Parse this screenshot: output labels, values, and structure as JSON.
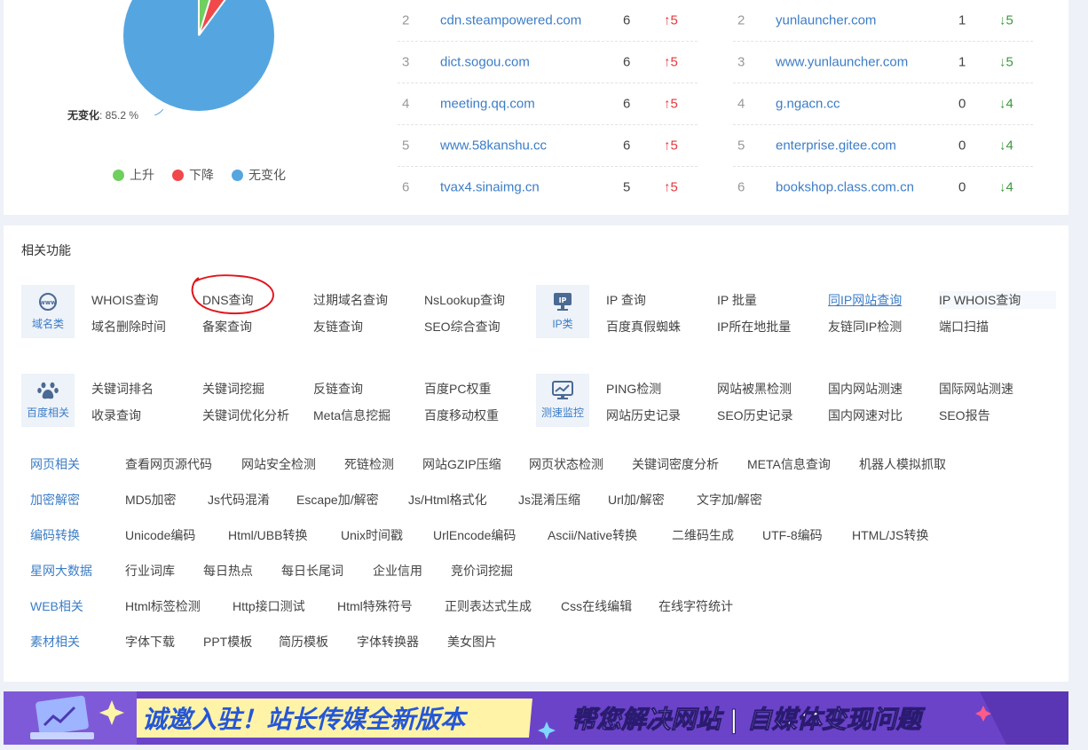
{
  "pie": {
    "label_name": "无变化",
    "label_value": ": 85.2 %",
    "legend": [
      {
        "label": "上升",
        "color": "#6fcf5f"
      },
      {
        "label": "下降",
        "color": "#f0484b"
      },
      {
        "label": "无变化",
        "color": "#55a6e0"
      }
    ]
  },
  "rank_up": [
    {
      "idx": "2",
      "domain": "cdn.steampowered.com",
      "count": "6",
      "change": "5"
    },
    {
      "idx": "3",
      "domain": "dict.sogou.com",
      "count": "6",
      "change": "5"
    },
    {
      "idx": "4",
      "domain": "meeting.qq.com",
      "count": "6",
      "change": "5"
    },
    {
      "idx": "5",
      "domain": "www.58kanshu.cc",
      "count": "6",
      "change": "5"
    },
    {
      "idx": "6",
      "domain": "tvax4.sinaimg.cn",
      "count": "5",
      "change": "5"
    }
  ],
  "rank_down": [
    {
      "idx": "2",
      "domain": "yunlauncher.com",
      "count": "1",
      "change": "5"
    },
    {
      "idx": "3",
      "domain": "www.yunlauncher.com",
      "count": "1",
      "change": "5"
    },
    {
      "idx": "4",
      "domain": "g.ngacn.cc",
      "count": "0",
      "change": "4"
    },
    {
      "idx": "5",
      "domain": "enterprise.gitee.com",
      "count": "0",
      "change": "4"
    },
    {
      "idx": "6",
      "domain": "bookshop.class.com.cn",
      "count": "0",
      "change": "4"
    }
  ],
  "related": {
    "title": "相关功能",
    "domain_cat": {
      "label": "域名类",
      "icon": "www-icon",
      "row1": [
        "WHOIS查询",
        "DNS查询",
        "过期域名查询",
        "NsLookup查询"
      ],
      "row2": [
        "域名删除时间",
        "备案查询",
        "友链查询",
        "SEO综合查询"
      ]
    },
    "ip_cat": {
      "label": "IP类",
      "icon": "ip-icon",
      "row1": [
        "IP 查询",
        "IP 批量",
        "同IP网站查询",
        "IP WHOIS查询"
      ],
      "row2": [
        "百度真假蜘蛛",
        "IP所在地批量",
        "友链同IP检测",
        "端口扫描"
      ]
    },
    "baidu_cat": {
      "label": "百度相关",
      "icon": "paw-icon",
      "row1": [
        "关键词排名",
        "关键词挖掘",
        "反链查询",
        "百度PC权重"
      ],
      "row2": [
        "收录查询",
        "关键词优化分析",
        "Meta信息挖掘",
        "百度移动权重"
      ]
    },
    "speed_cat": {
      "label": "测速监控",
      "icon": "monitor-chart-icon",
      "row1": [
        "PING检测",
        "网站被黑检测",
        "国内网站测速",
        "国际网站测速"
      ],
      "row2": [
        "网站历史记录",
        "SEO历史记录",
        "国内网速对比",
        "SEO报告"
      ]
    },
    "tool_rows": [
      {
        "label": "网页相关",
        "items": [
          "查看网页源代码",
          "网站安全检测",
          "死链检测",
          "网站GZIP压缩",
          "网页状态检测",
          "关键词密度分析",
          "META信息查询",
          "机器人模拟抓取"
        ]
      },
      {
        "label": "加密解密",
        "items": [
          "MD5加密",
          "Js代码混淆",
          "Escape加/解密",
          "Js/Html格式化",
          "Js混淆压缩",
          "Url加/解密",
          "文字加/解密"
        ]
      },
      {
        "label": "编码转换",
        "items": [
          "Unicode编码",
          "Html/UBB转换",
          "Unix时间戳",
          "UrlEncode编码",
          "Ascii/Native转换",
          "二维码生成",
          "UTF-8编码",
          "HTML/JS转换"
        ]
      },
      {
        "label": "星网大数据",
        "items": [
          "行业词库",
          "每日热点",
          "每日长尾词",
          "企业信用",
          "竞价词挖掘"
        ]
      },
      {
        "label": "WEB相关",
        "items": [
          "Html标签检测",
          "Http接口测试",
          "Html特殊符号",
          "正则表达式生成",
          "Css在线编辑",
          "在线字符统计"
        ]
      },
      {
        "label": "素材相关",
        "items": [
          "字体下载",
          "PPT模板",
          "简历模板",
          "字体转换器",
          "美女图片"
        ]
      }
    ]
  },
  "banner": {
    "left_text": "诚邀入驻！站长传媒全新版本",
    "right_text": "帮您解决网站 | 自媒体变现问题",
    "bg_color": "#6b43c9",
    "strip_color": "#fff3a8"
  }
}
